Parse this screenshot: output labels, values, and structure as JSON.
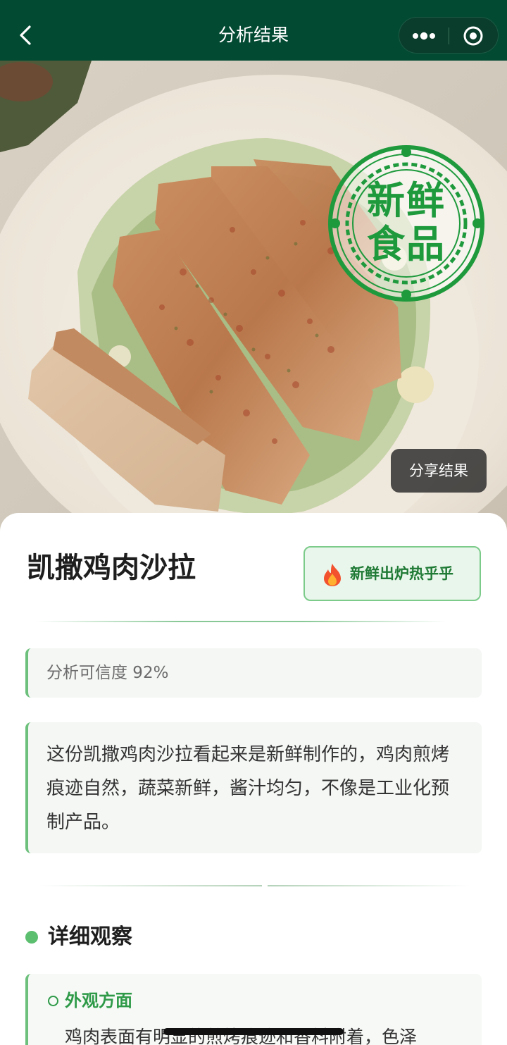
{
  "navbar": {
    "title": "分析结果",
    "back_icon": "chevron-left-icon",
    "more_icon": "more-dots-icon",
    "close_icon": "target-circle-icon",
    "background": "#034a33"
  },
  "photo": {
    "description_icon": "food-photo",
    "stamp": {
      "line1": "新鲜",
      "line2": "食品",
      "color": "#1e9a3d"
    },
    "share_label": "分享结果"
  },
  "result": {
    "dish_name": "凯撒鸡肉沙拉",
    "badge": {
      "icon": "fire-icon",
      "label": "新鲜出炉热乎乎"
    },
    "confidence": "分析可信度 92%",
    "summary": "这份凯撒鸡肉沙拉看起来是新鲜制作的，鸡肉煎烤痕迹自然，蔬菜新鲜，酱汁均匀，不像是工业化预制产品。",
    "accent_color": "#6cc07c"
  },
  "details": {
    "section_title": "详细观察",
    "items": [
      {
        "title": "外观方面",
        "text": "鸡肉表面有明显的煎烤痕迹和香料附着，色泽"
      }
    ]
  }
}
